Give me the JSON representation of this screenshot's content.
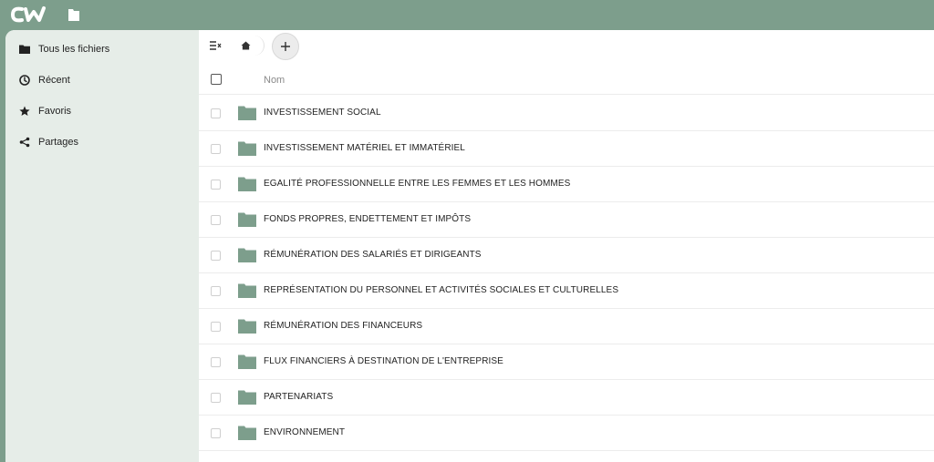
{
  "brand": {
    "logo_text": "CW"
  },
  "sidebar": {
    "items": [
      {
        "label": "Tous les fichiers",
        "icon": "folder-icon"
      },
      {
        "label": "Récent",
        "icon": "clock-icon"
      },
      {
        "label": "Favoris",
        "icon": "star-icon"
      },
      {
        "label": "Partages",
        "icon": "share-icon"
      }
    ]
  },
  "list": {
    "header": {
      "name_label": "Nom"
    },
    "folders": [
      {
        "name": "INVESTISSEMENT SOCIAL"
      },
      {
        "name": "INVESTISSEMENT MATÉRIEL ET IMMATÉRIEL"
      },
      {
        "name": "EGALITÉ PROFESSIONNELLE ENTRE LES FEMMES ET LES HOMMES"
      },
      {
        "name": "FONDS PROPRES, ENDETTEMENT ET IMPÔTS"
      },
      {
        "name": "RÉMUNÉRATION DES SALARIÉS ET DIRIGEANTS"
      },
      {
        "name": "REPRÉSENTATION DU PERSONNEL ET ACTIVITÉS SOCIALES ET CULTURELLES"
      },
      {
        "name": "RÉMUNÉRATION DES FINANCEURS"
      },
      {
        "name": "FLUX FINANCIERS À DESTINATION DE L'ENTREPRISE"
      },
      {
        "name": "PARTENARIATS"
      },
      {
        "name": "ENVIRONNEMENT"
      }
    ]
  },
  "colors": {
    "accent": "#7d9e8c",
    "sidebar_bg": "#e6ede8",
    "folder": "#7d9e8c"
  }
}
